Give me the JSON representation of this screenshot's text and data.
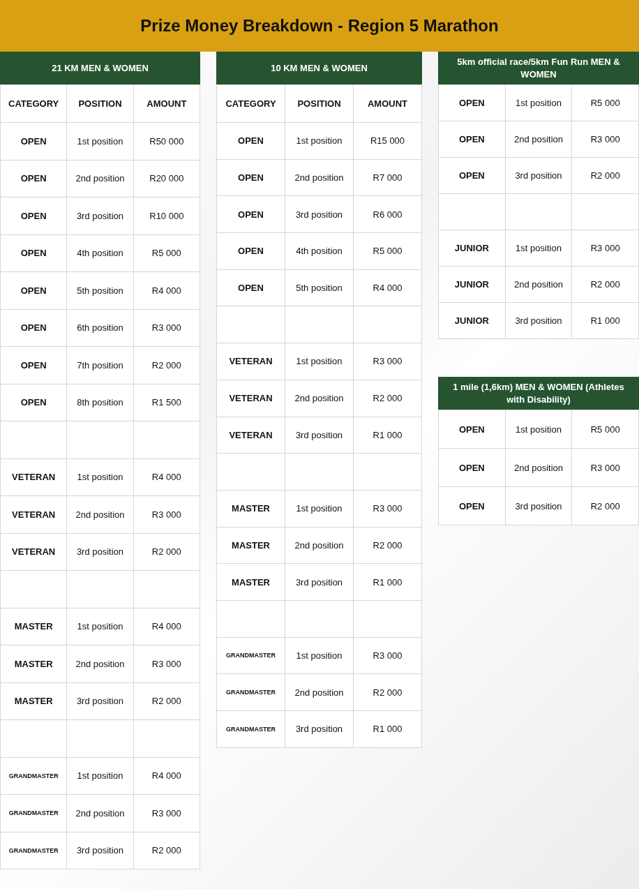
{
  "header": {
    "title": "Prize Money Breakdown - Region 5 Marathon"
  },
  "columns": [
    {
      "tables": [
        {
          "title": "21 KM MEN & WOMEN",
          "headers": [
            "CATEGORY",
            "POSITION",
            "AMOUNT"
          ],
          "rows": [
            {
              "kind": "prize",
              "category": "OPEN",
              "position": "1st position",
              "amount": "R50 000"
            },
            {
              "kind": "prize",
              "category": "OPEN",
              "position": "2nd position",
              "amount": "R20 000"
            },
            {
              "kind": "prize",
              "category": "OPEN",
              "position": "3rd position",
              "amount": "R10 000"
            },
            {
              "kind": "prize",
              "category": "OPEN",
              "position": "4th position",
              "amount": "R5 000"
            },
            {
              "kind": "prize",
              "category": "OPEN",
              "position": "5th position",
              "amount": "R4 000"
            },
            {
              "kind": "prize",
              "category": "OPEN",
              "position": "6th position",
              "amount": "R3 000"
            },
            {
              "kind": "prize",
              "category": "OPEN",
              "position": "7th position",
              "amount": "R2 000"
            },
            {
              "kind": "prize",
              "category": "OPEN",
              "position": "8th position",
              "amount": "R1 500"
            },
            {
              "kind": "spacer"
            },
            {
              "kind": "prize",
              "category": "VETERAN",
              "position": "1st position",
              "amount": "R4 000"
            },
            {
              "kind": "prize",
              "category": "VETERAN",
              "position": "2nd position",
              "amount": "R3 000"
            },
            {
              "kind": "prize",
              "category": "VETERAN",
              "position": "3rd position",
              "amount": "R2 000"
            },
            {
              "kind": "spacer"
            },
            {
              "kind": "prize",
              "category": "MASTER",
              "position": "1st position",
              "amount": "R4 000"
            },
            {
              "kind": "prize",
              "category": "MASTER",
              "position": "2nd position",
              "amount": "R3 000"
            },
            {
              "kind": "prize",
              "category": "MASTER",
              "position": "3rd position",
              "amount": "R2 000"
            },
            {
              "kind": "spacer"
            },
            {
              "kind": "prize",
              "category": "GRANDMASTER",
              "position": "1st position",
              "amount": "R4 000"
            },
            {
              "kind": "prize",
              "category": "GRANDMASTER",
              "position": "2nd position",
              "amount": "R3 000"
            },
            {
              "kind": "prize",
              "category": "GRANDMASTER",
              "position": "3rd position",
              "amount": "R2 000"
            }
          ]
        }
      ]
    },
    {
      "tables": [
        {
          "title": "10 KM MEN & WOMEN",
          "headers": [
            "CATEGORY",
            "POSITION",
            "AMOUNT"
          ],
          "rows": [
            {
              "kind": "prize",
              "category": "OPEN",
              "position": "1st position",
              "amount": "R15 000"
            },
            {
              "kind": "prize",
              "category": "OPEN",
              "position": "2nd position",
              "amount": "R7 000"
            },
            {
              "kind": "prize",
              "category": "OPEN",
              "position": "3rd position",
              "amount": "R6 000"
            },
            {
              "kind": "prize",
              "category": "OPEN",
              "position": "4th position",
              "amount": "R5 000"
            },
            {
              "kind": "prize",
              "category": "OPEN",
              "position": "5th position",
              "amount": "R4 000"
            },
            {
              "kind": "spacer"
            },
            {
              "kind": "prize",
              "category": "VETERAN",
              "position": "1st position",
              "amount": "R3 000"
            },
            {
              "kind": "prize",
              "category": "VETERAN",
              "position": "2nd position",
              "amount": "R2 000"
            },
            {
              "kind": "prize",
              "category": "VETERAN",
              "position": "3rd position",
              "amount": "R1 000"
            },
            {
              "kind": "spacer"
            },
            {
              "kind": "prize",
              "category": "MASTER",
              "position": "1st position",
              "amount": "R3 000"
            },
            {
              "kind": "prize",
              "category": "MASTER",
              "position": "2nd position",
              "amount": "R2 000"
            },
            {
              "kind": "prize",
              "category": "MASTER",
              "position": "3rd position",
              "amount": "R1 000"
            },
            {
              "kind": "spacer"
            },
            {
              "kind": "prize",
              "category": "GRANDMASTER",
              "position": "1st position",
              "amount": "R3 000"
            },
            {
              "kind": "prize",
              "category": "GRANDMASTER",
              "position": "2nd position",
              "amount": "R2 000"
            },
            {
              "kind": "prize",
              "category": "GRANDMASTER",
              "position": "3rd position",
              "amount": "R1 000"
            }
          ]
        }
      ]
    },
    {
      "tables": [
        {
          "title": "5km official race/5km Fun Run MEN & WOMEN",
          "rows": [
            {
              "kind": "prize",
              "category": "OPEN",
              "position": "1st position",
              "amount": "R5 000"
            },
            {
              "kind": "prize",
              "category": "OPEN",
              "position": "2nd position",
              "amount": "R3 000"
            },
            {
              "kind": "prize",
              "category": "OPEN",
              "position": "3rd position",
              "amount": "R2 000"
            },
            {
              "kind": "spacer"
            },
            {
              "kind": "prize",
              "category": "JUNIOR",
              "position": "1st position",
              "amount": "R3 000"
            },
            {
              "kind": "prize",
              "category": "JUNIOR",
              "position": "2nd position",
              "amount": "R2 000"
            },
            {
              "kind": "prize",
              "category": "JUNIOR",
              "position": "3rd position",
              "amount": "R1 000"
            }
          ]
        },
        {
          "title": "1 mile (1,6km) MEN & WOMEN (Athletes with Disability)",
          "rows": [
            {
              "kind": "prize",
              "category": "OPEN",
              "position": "1st position",
              "amount": "R5 000"
            },
            {
              "kind": "prize",
              "category": "OPEN",
              "position": "2nd position",
              "amount": "R3 000"
            },
            {
              "kind": "prize",
              "category": "OPEN",
              "position": "3rd position",
              "amount": "R2 000"
            }
          ]
        }
      ]
    }
  ]
}
